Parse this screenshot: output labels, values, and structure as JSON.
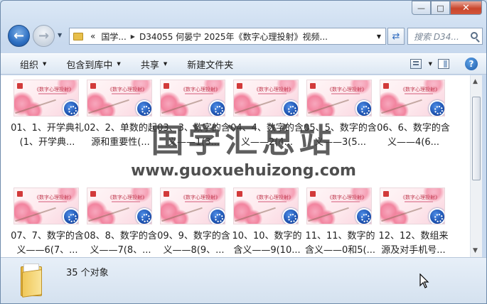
{
  "window": {
    "caption": {
      "minimize": "—",
      "maximize": "□",
      "close": "✕"
    }
  },
  "nav": {
    "back_icon": "back-arrow-icon",
    "forward_icon": "forward-arrow-icon",
    "address": {
      "prefix": "«",
      "segments": [
        "国学...",
        "D34055 何晏宁 2025年《数字心理投射》视频..."
      ]
    },
    "search_placeholder": "搜索 D34..."
  },
  "toolbar": {
    "organize": "组织",
    "include_in_library": "包含到库中",
    "share": "共享",
    "new_folder": "新建文件夹"
  },
  "files": [
    {
      "label": "01、1、开学典礼(1、开学典..."
    },
    {
      "label": "02、2、单数的起源和重要性(..."
    },
    {
      "label": "03、3、数字的含义——1(3..."
    },
    {
      "label": "04、4、数字的含义——2(4..."
    },
    {
      "label": "05、5、数字的含义——3(5..."
    },
    {
      "label": "06、6、数字的含义——4(6..."
    },
    {
      "label": "07、7、数字的含义——6(7、..."
    },
    {
      "label": "08、8、数字的含义——7(8、..."
    },
    {
      "label": "09、9、数字的含义——8(9、..."
    },
    {
      "label": "10、10、数字的含义——9(10..."
    },
    {
      "label": "11、11、数字的含义——0和5(..."
    },
    {
      "label": "12、12、数组来源及对手机号..."
    }
  ],
  "thumb_title": "《数字心理投射》",
  "status": {
    "count": "35 个对象"
  },
  "watermark": {
    "main": "国学汇总站",
    "url": "www.guoxuehuizong.com"
  }
}
